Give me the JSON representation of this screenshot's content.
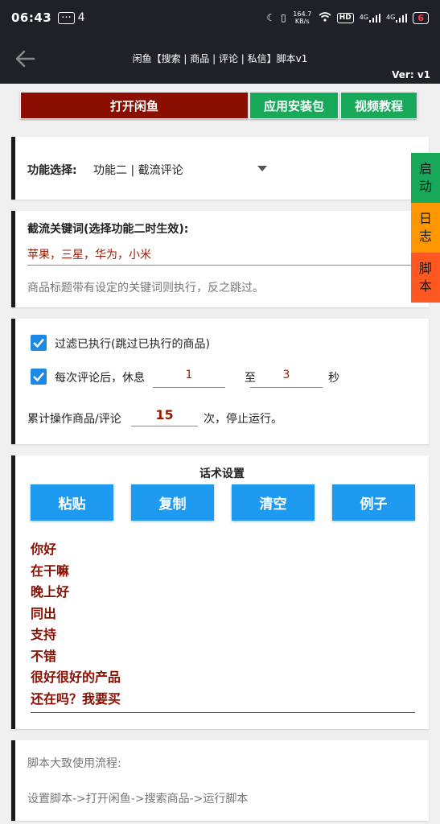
{
  "status_bar": {
    "time": "06:43",
    "notification_count": "4",
    "net_speed": "164.7 KB/s",
    "hd_badge": "HD",
    "signal1": "4G",
    "signal2": "4G",
    "battery": "6"
  },
  "app_bar": {
    "title": "闲鱼【搜索 | 商品 | 评论 | 私信】脚本v1",
    "version": "Ver: v1"
  },
  "top_buttons": {
    "open_xianyu": "打开闲鱼",
    "install_pkg": "应用安装包",
    "video_tutorial": "视频教程"
  },
  "function_card": {
    "label": "功能选择:",
    "selected": "功能二 | 截流评论"
  },
  "keyword_card": {
    "title": "截流关键词(选择功能二时生效):",
    "value": "苹果，三星，华为，小米",
    "hint": "商品标题带有设定的关键词则执行，反之跳过。"
  },
  "options_card": {
    "filter_label": "过滤已执行(跳过已执行的商品)",
    "rest_prefix": "每次评论后，休息",
    "rest_min": "1",
    "rest_to": "至",
    "rest_max": "3",
    "rest_unit": "秒",
    "total_prefix": "累计操作商品/评论",
    "total_value": "15",
    "total_suffix": "次，停止运行。"
  },
  "script_card": {
    "title": "话术设置",
    "buttons": {
      "paste": "粘贴",
      "copy": "复制",
      "clear": "清空",
      "example": "例子"
    },
    "lines": [
      "你好",
      "在干嘛",
      "晚上好",
      "同出",
      "支持",
      "不错",
      "很好很好的产品",
      "还在吗？我要买"
    ]
  },
  "flow_card": {
    "title": "脚本大致使用流程:",
    "steps": "设置脚本->打开闲鱼->搜索商品->运行脚本"
  },
  "side_tabs": {
    "start": [
      "启",
      "动"
    ],
    "log": [
      "日",
      "志"
    ],
    "script": [
      "脚",
      "本"
    ]
  },
  "colors": {
    "dark_bar": "#1f2128",
    "open_button": "#8a0f00",
    "green_button": "#18a85a",
    "blue_button": "#1e9bf0",
    "accent_text": "#8a0f00",
    "tab_log": "#ff9800",
    "tab_script": "#ff5722"
  }
}
